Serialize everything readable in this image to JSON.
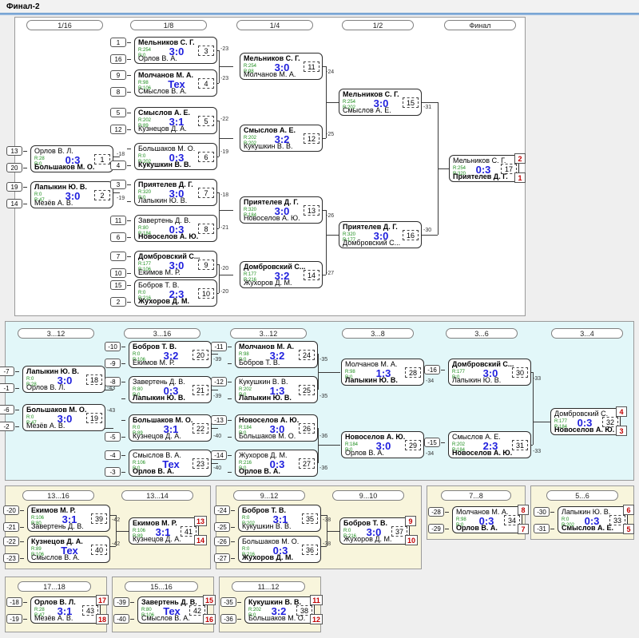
{
  "window": {
    "title": "Финал-2"
  },
  "panels": {
    "main": {
      "rounds": [
        "1/16",
        "1/8",
        "1/4",
        "1/2",
        "Финал"
      ]
    },
    "lower": {
      "rounds": [
        "3...12",
        "3...16",
        "3...12",
        "3...8",
        "3...6",
        "3...4"
      ]
    },
    "p1316": {
      "rounds": [
        "13...16",
        "13...14"
      ]
    },
    "p912": {
      "rounds": [
        "9...12",
        "9...10"
      ]
    },
    "p78": {
      "rounds": [
        "7...8"
      ]
    },
    "p56": {
      "rounds": [
        "5...6"
      ]
    },
    "p1718": {
      "rounds": [
        "17...18"
      ]
    },
    "p1516": {
      "rounds": [
        "15...16"
      ]
    },
    "p1112": {
      "rounds": [
        "11...12"
      ]
    }
  },
  "matches": {
    "m1": {
      "id": "1",
      "a": "Орлов В. Л.",
      "b": "Большаков М. О.",
      "ra": "R:28",
      "rb": "R:0",
      "score": "0:3",
      "winner": "b",
      "sa": "13",
      "sb": "20",
      "cid": "-18"
    },
    "m2": {
      "id": "2",
      "a": "Лапыкин Ю. В.",
      "b": "Мезёв А. В.",
      "ra": "R:0",
      "rb": "R:47",
      "score": "3:0",
      "winner": "a",
      "sa": "19",
      "sb": "14",
      "cid": "-19"
    },
    "m3": {
      "id": "3",
      "a": "Мельников С. Г.",
      "b": "Орлов В. А.",
      "ra": "R:254",
      "rb": "R:0",
      "score": "3:0",
      "winner": "a",
      "sa": "1",
      "sb": "16",
      "cid": "-23"
    },
    "m4": {
      "id": "4",
      "a": "Молчанов М. А.",
      "b": "Смыслов В. А.",
      "ra": "R:98",
      "rb": "R:106",
      "score": "Тех",
      "winner": "a",
      "sa": "9",
      "sb": "8",
      "cid": "-23"
    },
    "m5": {
      "id": "5",
      "a": "Смыслов А. Е.",
      "b": "Кузнецов Д. А.",
      "ra": "R:202",
      "rb": "R:89",
      "score": "3:1",
      "winner": "a",
      "sa": "5",
      "sb": "12",
      "cid": "-22"
    },
    "m6": {
      "id": "6",
      "a": "Большаков М. О.",
      "b": "Кукушкин В. В.",
      "ra": "R:0",
      "rb": "R:202",
      "score": "0:3",
      "winner": "b",
      "sa": "",
      "sb": "4",
      "cid": "-19"
    },
    "m7": {
      "id": "7",
      "a": "Приятелев Д. Г.",
      "b": "Лапыкин Ю. В.",
      "ra": "R:320",
      "rb": "R:0",
      "score": "3:0",
      "winner": "a",
      "sa": "3",
      "sb": "",
      "cid": "-18"
    },
    "m8": {
      "id": "8",
      "a": "Завертень Д. В.",
      "b": "Новоселов А. Ю.",
      "ra": "R:80",
      "rb": "R:184",
      "score": "0:3",
      "winner": "b",
      "sa": "11",
      "sb": "6",
      "cid": "-21"
    },
    "m9": {
      "id": "9",
      "a": "Домбровский С...",
      "b": "Екимов М. Р.",
      "ra": "R:177",
      "rb": "R:106",
      "score": "3:0",
      "winner": "a",
      "sa": "7",
      "sb": "10",
      "cid": "-20"
    },
    "m10": {
      "id": "10",
      "a": "Бобров Т. В.",
      "b": "Жухоров Д. М.",
      "ra": "R:0",
      "rb": "R:216",
      "score": "2:3",
      "winner": "b",
      "sa": "15",
      "sb": "2",
      "cid": "-20"
    },
    "m11": {
      "id": "11",
      "a": "Мельников С. Г.",
      "b": "Молчанов М. А.",
      "ra": "R:254",
      "rb": "R:98",
      "score": "3:0",
      "winner": "a",
      "cid": "-24"
    },
    "m12": {
      "id": "12",
      "a": "Смыслов А. Е.",
      "b": "Кукушкин В. В.",
      "ra": "R:202",
      "rb": "R:202",
      "score": "3:2",
      "winner": "a",
      "cid": "-25"
    },
    "m13": {
      "id": "13",
      "a": "Приятелев Д. Г.",
      "b": "Новоселов А. Ю.",
      "ra": "R:320",
      "rb": "R:184",
      "score": "3:0",
      "winner": "a",
      "cid": "-26"
    },
    "m14": {
      "id": "14",
      "a": "Домбровский С...",
      "b": "Жухоров Д. М.",
      "ra": "R:177",
      "rb": "R:216",
      "score": "3:2",
      "winner": "a",
      "cid": "-27"
    },
    "m15": {
      "id": "15",
      "a": "Мельников С. Г.",
      "b": "Смыслов А. Е.",
      "ra": "R:254",
      "rb": "R:202",
      "score": "3:0",
      "winner": "a",
      "cid": "-31"
    },
    "m16": {
      "id": "16",
      "a": "Приятелев Д. Г.",
      "b": "Домбровский С...",
      "ra": "R:320",
      "rb": "R:177",
      "score": "3:0",
      "winner": "a",
      "cid": "-30"
    },
    "m17": {
      "id": "17",
      "a": "Мельников С. Г.",
      "b": "Приятелев Д. Г.",
      "ra": "R:254",
      "rb": "R:320",
      "score": "0:3",
      "winner": "b",
      "pa": "2",
      "pb": "1"
    },
    "m18": {
      "id": "18",
      "a": "Лапыкин Ю. В.",
      "b": "Орлов В. Л.",
      "ra": "R:0",
      "rb": "R:28",
      "score": "3:0",
      "winner": "a",
      "sa": "-7",
      "sb": "-1",
      "cid": "-43"
    },
    "m19": {
      "id": "19",
      "a": "Большаков М. О.",
      "b": "Мезёв А. В.",
      "ra": "R:0",
      "rb": "R:47",
      "score": "3:0",
      "winner": "a",
      "sa": "-6",
      "sb": "-2",
      "cid": "-43"
    },
    "m20": {
      "id": "20",
      "a": "Бобров Т. В.",
      "b": "Екимов М. Р.",
      "ra": "R:0",
      "rb": "R:106",
      "score": "3:2",
      "winner": "a",
      "sa": "-10",
      "sb": "-9",
      "cid": "-39"
    },
    "m21": {
      "id": "21",
      "a": "Завертень Д. В.",
      "b": "Лапыкин Ю. В.",
      "ra": "R:80",
      "rb": "R:0",
      "score": "0:3",
      "winner": "b",
      "sa": "-8",
      "sb": "",
      "cid": "-39"
    },
    "m22": {
      "id": "22",
      "a": "Большаков М. О.",
      "b": "Кузнецов Д. А.",
      "ra": "R:0",
      "rb": "R:89",
      "score": "3:1",
      "winner": "a",
      "sa": "",
      "sb": "-5",
      "cid": "-40"
    },
    "m23": {
      "id": "23",
      "a": "Смыслов В. А.",
      "b": "Орлов В. А.",
      "ra": "R:106",
      "rb": "R:0",
      "score": "Тех",
      "winner": "b",
      "sa": "-4",
      "sb": "-3",
      "cid": "-40"
    },
    "m24": {
      "id": "24",
      "a": "Молчанов М. А.",
      "b": "Бобров Т. В.",
      "ra": "R:98",
      "rb": "R:0",
      "score": "3:2",
      "winner": "a",
      "sa": "-11",
      "sb": "",
      "cid": "-35"
    },
    "m25": {
      "id": "25",
      "a": "Кукушкин В. В.",
      "b": "Лапыкин Ю. В.",
      "ra": "R:202",
      "rb": "R:0",
      "score": "1:3",
      "winner": "b",
      "sa": "-12",
      "sb": "",
      "cid": "-35"
    },
    "m26": {
      "id": "26",
      "a": "Новоселов А. Ю.",
      "b": "Большаков М. О.",
      "ra": "R:184",
      "rb": "R:0",
      "score": "3:0",
      "winner": "a",
      "sa": "-13",
      "sb": "",
      "cid": "-36"
    },
    "m27": {
      "id": "27",
      "a": "Жухоров Д. М.",
      "b": "Орлов В. А.",
      "ra": "R:216",
      "rb": "R:0",
      "score": "0:3",
      "winner": "b",
      "sa": "-14",
      "sb": "",
      "cid": "-36"
    },
    "m28": {
      "id": "28",
      "a": "Молчанов М. А.",
      "b": "Лапыкин Ю. В.",
      "ra": "R:98",
      "rb": "R:0",
      "score": "1:3",
      "winner": "b",
      "cid": "-34"
    },
    "m29": {
      "id": "29",
      "a": "Новоселов А. Ю.",
      "b": "Орлов В. А.",
      "ra": "R:184",
      "rb": "R:0",
      "score": "3:0",
      "winner": "a",
      "cid": "-34"
    },
    "m30": {
      "id": "30",
      "a": "Домбровский С...",
      "b": "Лапыкин Ю. В.",
      "ra": "R:177",
      "rb": "R:0",
      "score": "3:0",
      "winner": "a",
      "sa": "-16",
      "cid": "-33"
    },
    "m31": {
      "id": "31",
      "a": "Смыслов А. Е.",
      "b": "Новоселов А. Ю.",
      "ra": "R:202",
      "rb": "R:184",
      "score": "2:3",
      "winner": "b",
      "sa": "-15",
      "cid": "-33"
    },
    "m32": {
      "id": "32",
      "a": "Домбровский С.",
      "b": "Новоселов А. Ю.",
      "ra": "R:177",
      "rb": "R:184",
      "score": "0:3",
      "winner": "b",
      "pa": "4",
      "pb": "3"
    },
    "m39": {
      "id": "39",
      "a": "Екимов М. Р.",
      "b": "Завертень Д. В.",
      "ra": "R:106",
      "rb": "R:80",
      "score": "3:1",
      "winner": "a",
      "sa": "-20",
      "sb": "-21",
      "cid": "-42"
    },
    "m40": {
      "id": "40",
      "a": "Кузнецов Д. А.",
      "b": "Смыслов В. А.",
      "ra": "R:89",
      "rb": "R:106",
      "score": "Тех",
      "winner": "a",
      "sa": "-22",
      "sb": "-23",
      "cid": "-42"
    },
    "m41": {
      "id": "41",
      "a": "Екимов М. Р.",
      "b": "Кузнецов Д. А.",
      "ra": "R:106",
      "rb": "R:89",
      "score": "3:1",
      "winner": "a",
      "pa": "13",
      "pb": "14"
    },
    "m35": {
      "id": "35",
      "a": "Бобров Т. В.",
      "b": "Кукушкин В. В.",
      "ra": "R:0",
      "rb": "R:202",
      "score": "3:1",
      "winner": "a",
      "sa": "-24",
      "sb": "-25",
      "cid": "-38"
    },
    "m36": {
      "id": "36",
      "a": "Большаков М. О.",
      "b": "Жухоров Д. М.",
      "ra": "R:0",
      "rb": "R:216",
      "score": "0:3",
      "winner": "b",
      "sa": "-26",
      "sb": "-27",
      "cid": "-38"
    },
    "m37": {
      "id": "37",
      "a": "Бобров Т. В.",
      "b": "Жухоров Д. М.",
      "ra": "R:0",
      "rb": "R:216",
      "score": "3:0",
      "winner": "a",
      "pa": "9",
      "pb": "10"
    },
    "m34": {
      "id": "34",
      "a": "Молчанов М. А.",
      "b": "Орлов В. А.",
      "ra": "R:98",
      "rb": "R:0",
      "score": "0:3",
      "winner": "b",
      "sa": "-28",
      "sb": "-29",
      "pa": "8",
      "pb": "7"
    },
    "m33": {
      "id": "33",
      "a": "Лапыкин Ю. В.",
      "b": "Смыслов А. Е.",
      "ra": "R:0",
      "rb": "R:202",
      "score": "0:3",
      "winner": "b",
      "sa": "-30",
      "sb": "-31",
      "pa": "6",
      "pb": "5"
    },
    "m43": {
      "id": "43",
      "a": "Орлов В. Л.",
      "b": "Мезёв А. В.",
      "ra": "R:28",
      "rb": "R:47",
      "score": "3:1",
      "winner": "a",
      "sa": "-18",
      "sb": "-19",
      "pa": "17",
      "pb": "18"
    },
    "m42": {
      "id": "42",
      "a": "Завертень Д. В.",
      "b": "Смыслов В. А.",
      "ra": "R:80",
      "rb": "R:106",
      "score": "Тех",
      "winner": "a",
      "sa": "-39",
      "sb": "-40",
      "pa": "15",
      "pb": "16"
    },
    "m38": {
      "id": "38",
      "a": "Кукушкин В. В.",
      "b": "Большаков М. О.",
      "ra": "R:202",
      "rb": "R:0",
      "score": "3:2",
      "winner": "a",
      "sa": "-35",
      "sb": "-36",
      "pa": "11",
      "pb": "12"
    }
  },
  "colors": {
    "score": "#2020dd",
    "rating": "#1a8c1a",
    "place": "#c00000",
    "panel_cyan": "#e2f7f9",
    "panel_cream": "#f8f5dc",
    "background": "#efefef",
    "accent": "#8fb4dd"
  }
}
